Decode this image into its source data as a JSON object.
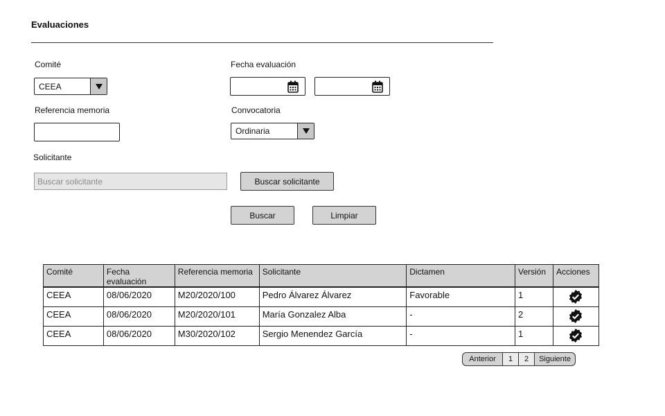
{
  "page": {
    "title": "Evaluaciones"
  },
  "filters": {
    "comite": {
      "label": "Comité",
      "value": "CEEA"
    },
    "fecha_evaluacion": {
      "label": "Fecha evaluación",
      "from_value": "",
      "to_value": ""
    },
    "referencia_memoria": {
      "label": "Referencia memoria",
      "value": ""
    },
    "convocatoria": {
      "label": "Convocatoria",
      "value": "Ordinaria"
    },
    "solicitante": {
      "label": "Solicitante",
      "placeholder": "Buscar solicitante",
      "button_label": "Buscar solicitante"
    }
  },
  "actions": {
    "search_label": "Buscar",
    "clear_label": "Limpiar"
  },
  "table": {
    "headers": [
      "Comité",
      "Fecha evaluación",
      "Referencia memoria",
      "Solicitante",
      "Dictamen",
      "Versión",
      "Acciones"
    ],
    "rows": [
      {
        "comite": "CEEA",
        "fecha": "08/06/2020",
        "referencia": "M20/2020/100",
        "solicitante": "Pedro Álvarez Álvarez",
        "dictamen": "Favorable",
        "version": "1",
        "action_icon": "verified-badge-icon"
      },
      {
        "comite": "CEEA",
        "fecha": "08/06/2020",
        "referencia": "M20/2020/101",
        "solicitante": "María Gonzalez Alba",
        "dictamen": "-",
        "version": "2",
        "action_icon": "verified-badge-icon"
      },
      {
        "comite": "CEEA",
        "fecha": "08/06/2020",
        "referencia": "M30/2020/102",
        "solicitante": "Sergio Menendez García",
        "dictamen": "-",
        "version": "1",
        "action_icon": "verified-badge-icon"
      }
    ]
  },
  "pagination": {
    "prev_label": "Anterior",
    "pages": [
      "1",
      "2"
    ],
    "next_label": "Siguiente"
  }
}
